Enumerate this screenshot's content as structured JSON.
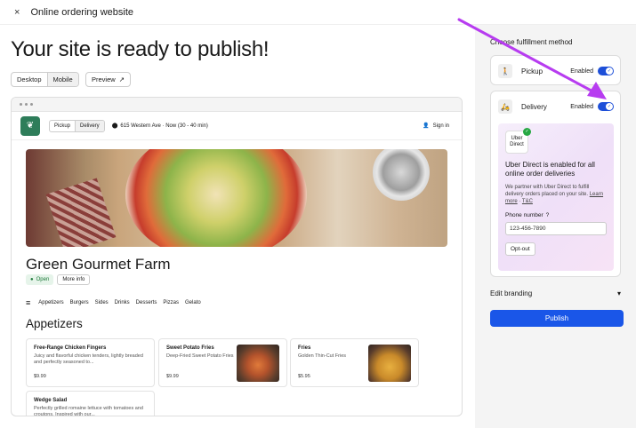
{
  "topbar": {
    "close_glyph": "×",
    "title": "Online ordering website"
  },
  "main": {
    "heading": "Your site is ready to publish!",
    "view_tabs": [
      "Desktop",
      "Mobile"
    ],
    "preview_label": "Preview"
  },
  "site": {
    "pickup": "Pickup",
    "delivery": "Delivery",
    "address": "615 Western Ave · Now (30 - 40 min)",
    "signin": "Sign in",
    "restaurant_name": "Green Gourmet Farm",
    "open_badge": "Open",
    "more_info": "More info",
    "categories": [
      "Appetizers",
      "Burgers",
      "Sides",
      "Drinks",
      "Desserts",
      "Pizzas",
      "Gelato"
    ],
    "section_title": "Appetizers",
    "items": [
      {
        "name": "Free-Range Chicken Fingers",
        "desc": "Juicy and flavorful chicken tenders, lightly breaded and perfectly seasoned to...",
        "price": "$9.99"
      },
      {
        "name": "Sweet Potato Fries",
        "desc": "Deep-Fried Sweet Potato Fries",
        "price": "$9.99"
      },
      {
        "name": "Fries",
        "desc": "Golden Thin-Cut Fries",
        "price": "$5.95"
      },
      {
        "name": "Wedge Salad",
        "desc": "Perfectly grilled romaine lettuce with tomatoes and croutons. Inspired with our...",
        "price": ""
      }
    ]
  },
  "sidebar": {
    "heading": "Choose fulfillment method",
    "pickup_label": "Pickup",
    "pickup_status": "Enabled",
    "delivery_label": "Delivery",
    "delivery_status": "Enabled",
    "uber_logo": "Uber Direct",
    "uber_heading": "Uber Direct is enabled for all online order deliveries",
    "uber_desc": "We partner with Uber Direct to fulfill delivery orders placed on your site.",
    "learn_more": "Learn more",
    "tc": "T&C",
    "phone_label": "Phone number",
    "phone_value": "123-456-7890",
    "optout": "Opt-out",
    "edit_branding": "Edit branding",
    "publish": "Publish"
  },
  "colors": {
    "accent": "#1a56e8",
    "arrow": "#b73cf0",
    "open_green": "#1e7a3a"
  }
}
